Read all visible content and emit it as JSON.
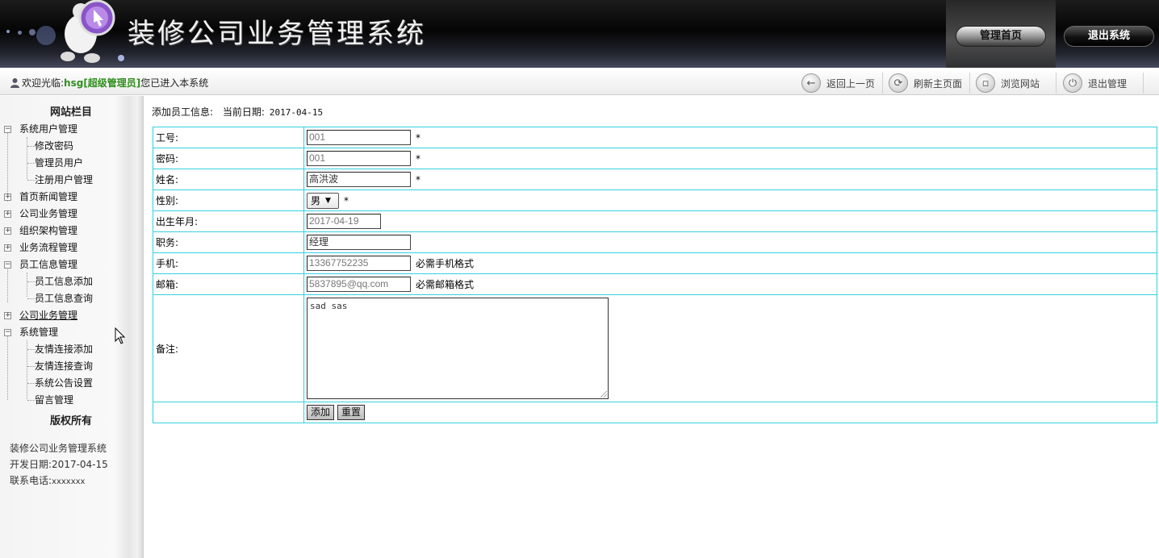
{
  "header": {
    "title": "装修公司业务管理系统",
    "home_button": "管理首页",
    "logout_button": "退出系统"
  },
  "welcome": {
    "prefix": "欢迎光临:",
    "username": "hsg[超级管理员]",
    "suffix": "您已进入本系统",
    "icon": "user-icon"
  },
  "toolbar": {
    "items": [
      {
        "label": "返回上一页",
        "icon": "back-arrow-icon"
      },
      {
        "label": "刷新主页面",
        "icon": "refresh-icon"
      },
      {
        "label": "浏览网站",
        "icon": "browse-icon"
      },
      {
        "label": "退出管理",
        "icon": "power-icon"
      }
    ]
  },
  "sidebar": {
    "heading": "网站栏目",
    "groups": [
      {
        "label": "系统用户管理",
        "expanded": true,
        "children": [
          "修改密码",
          "管理员用户",
          "注册用户管理"
        ]
      },
      {
        "label": "首页新闻管理",
        "expanded": false,
        "children": []
      },
      {
        "label": "公司业务管理",
        "expanded": false,
        "children": []
      },
      {
        "label": "组织架构管理",
        "expanded": false,
        "children": []
      },
      {
        "label": "业务流程管理",
        "expanded": false,
        "children": []
      },
      {
        "label": "员工信息管理",
        "expanded": true,
        "children": [
          "员工信息添加",
          "员工信息查询"
        ]
      },
      {
        "label": "公司业务管理",
        "expanded": false,
        "children": []
      },
      {
        "label": "系统管理",
        "expanded": true,
        "children": [
          "友情连接添加",
          "友情连接查询",
          "系统公告设置",
          "留言管理"
        ]
      }
    ],
    "copyright_heading": "版权所有",
    "info": {
      "system_name": "装修公司业务管理系统",
      "dev_date_label": "开发日期:",
      "dev_date": "2017-04-15",
      "phone_label": "联系电话:",
      "phone": "xxxxxxx"
    }
  },
  "content": {
    "title": "添加员工信息:",
    "date_label": "当前日期:",
    "date": "2017-04-15",
    "form": {
      "fields": [
        {
          "label": "工号:",
          "value": "001",
          "required": "*"
        },
        {
          "label": "密码:",
          "value": "001",
          "required": "*"
        },
        {
          "label": "姓名:",
          "value": "高洪波",
          "required": "*"
        },
        {
          "label": "性别:",
          "value": "男",
          "required": "*"
        },
        {
          "label": "出生年月:",
          "value": "2017-04-19"
        },
        {
          "label": "职务:",
          "value": "经理"
        },
        {
          "label": "手机:",
          "value": "13367752235",
          "hint": "必需手机格式"
        },
        {
          "label": "邮箱:",
          "value": "5837895@qq.com",
          "hint": "必需邮箱格式"
        },
        {
          "label": "备注:",
          "value": "sad sas"
        }
      ],
      "submit_label": "添加",
      "reset_label": "重置"
    }
  },
  "colors": {
    "table_border": "#35d0e0",
    "username_color": "#2f8f1d",
    "header_bg": "#050505"
  }
}
